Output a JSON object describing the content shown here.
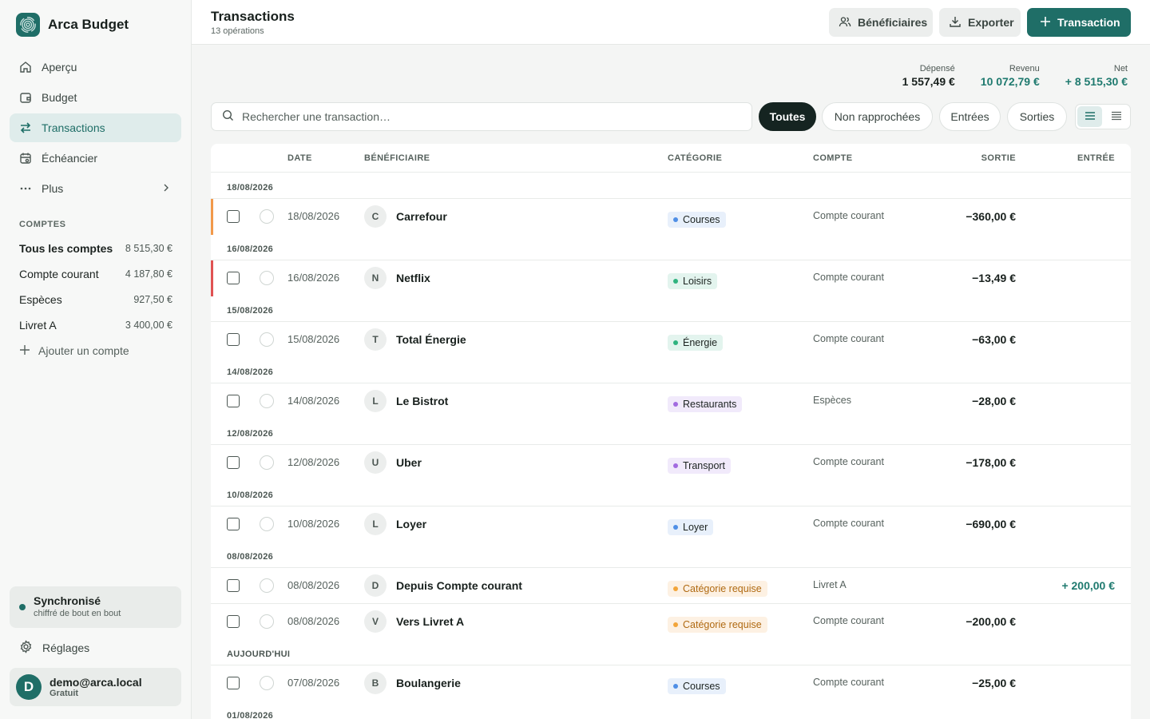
{
  "app": {
    "name": "Arca Budget"
  },
  "nav": [
    {
      "label": "Aperçu",
      "icon": "home-icon"
    },
    {
      "label": "Budget",
      "icon": "wallet-icon"
    },
    {
      "label": "Transactions",
      "icon": "swap-icon",
      "active": true
    },
    {
      "label": "Échéancier",
      "icon": "calendar-icon"
    },
    {
      "label": "Plus",
      "icon": "more-icon"
    }
  ],
  "accounts": {
    "title": "COMPTES",
    "items": [
      {
        "name": "Tous les comptes",
        "balance": "8 515,30 €"
      },
      {
        "name": "Compte courant",
        "balance": "4 187,80 €"
      },
      {
        "name": "Espèces",
        "balance": "927,50 €"
      },
      {
        "name": "Livret A",
        "balance": "3 400,00 €"
      }
    ],
    "add_label": "Ajouter un compte"
  },
  "sync": {
    "title": "Synchronisé",
    "subtitle": "chiffré de bout en bout"
  },
  "settings_label": "Réglages",
  "user": {
    "initial": "D",
    "email": "demo@arca.local",
    "plan": "Gratuit"
  },
  "header": {
    "title": "Transactions",
    "subtitle": "13 opérations",
    "buttons": {
      "payees": "Bénéficiaires",
      "export": "Exporter",
      "add": "Transaction"
    }
  },
  "totals": {
    "spent_label": "Dépensé",
    "spent": "1 557,49 €",
    "income_label": "Revenu",
    "income": "10 072,79 €",
    "net_label": "Net",
    "net": "+ 8 515,30 €"
  },
  "search": {
    "placeholder": "Rechercher une transaction…",
    "value": ""
  },
  "filters": [
    "Toutes",
    "Non rapprochées",
    "Entrées",
    "Sorties"
  ],
  "columns": {
    "date": "DATE",
    "payee": "BÉNÉFICIAIRE",
    "category": "CATÉGORIE",
    "account": "COMPTE",
    "out": "SORTIE",
    "in": "ENTRÉE"
  },
  "colors": {
    "accent": "#1f6e67",
    "warning": "#f2994a",
    "danger": "#e05252"
  },
  "groups": [
    {
      "label": "18/08/2026",
      "rows": [
        {
          "initial": "C",
          "date": "18/08/2026",
          "payee": "Carrefour",
          "category": "Courses",
          "cat_style": "blue",
          "account": "Compte courant",
          "out": "−360,00 €",
          "in": "",
          "flag": "warning"
        }
      ]
    },
    {
      "label": "16/08/2026",
      "rows": [
        {
          "initial": "N",
          "date": "16/08/2026",
          "payee": "Netflix",
          "category": "Loisirs",
          "cat_style": "green",
          "account": "Compte courant",
          "out": "−13,49 €",
          "in": "",
          "flag": "danger"
        }
      ]
    },
    {
      "label": "15/08/2026",
      "rows": [
        {
          "initial": "T",
          "date": "15/08/2026",
          "payee": "Total Énergie",
          "category": "Énergie",
          "cat_style": "green",
          "account": "Compte courant",
          "out": "−63,00 €",
          "in": "",
          "flag": ""
        }
      ]
    },
    {
      "label": "14/08/2026",
      "rows": [
        {
          "initial": "L",
          "date": "14/08/2026",
          "payee": "Le Bistrot",
          "category": "Restaurants",
          "cat_style": "purple",
          "account": "Espèces",
          "out": "−28,00 €",
          "in": "",
          "flag": ""
        }
      ]
    },
    {
      "label": "12/08/2026",
      "rows": [
        {
          "initial": "U",
          "date": "12/08/2026",
          "payee": "Uber",
          "category": "Transport",
          "cat_style": "purple",
          "account": "Compte courant",
          "out": "−178,00 €",
          "in": "",
          "flag": ""
        }
      ]
    },
    {
      "label": "10/08/2026",
      "rows": [
        {
          "initial": "L",
          "date": "10/08/2026",
          "payee": "Loyer",
          "category": "Loyer",
          "cat_style": "blue",
          "account": "Compte courant",
          "out": "−690,00 €",
          "in": "",
          "flag": ""
        }
      ]
    },
    {
      "label": "08/08/2026",
      "rows": [
        {
          "initial": "D",
          "date": "08/08/2026",
          "payee": "Depuis Compte courant",
          "category": "Catégorie requise",
          "cat_style": "orange",
          "account": "Livret A",
          "out": "",
          "in": "+ 200,00 €",
          "flag": ""
        },
        {
          "initial": "V",
          "date": "08/08/2026",
          "payee": "Vers Livret A",
          "category": "Catégorie requise",
          "cat_style": "orange",
          "account": "Compte courant",
          "out": "−200,00 €",
          "in": "",
          "flag": ""
        }
      ]
    },
    {
      "label": "AUJOURD'HUI",
      "rows": [
        {
          "initial": "B",
          "date": "07/08/2026",
          "payee": "Boulangerie",
          "category": "Courses",
          "cat_style": "blue",
          "account": "Compte courant",
          "out": "−25,00 €",
          "in": "",
          "flag": ""
        }
      ]
    },
    {
      "label": "01/08/2026",
      "rows": []
    }
  ]
}
